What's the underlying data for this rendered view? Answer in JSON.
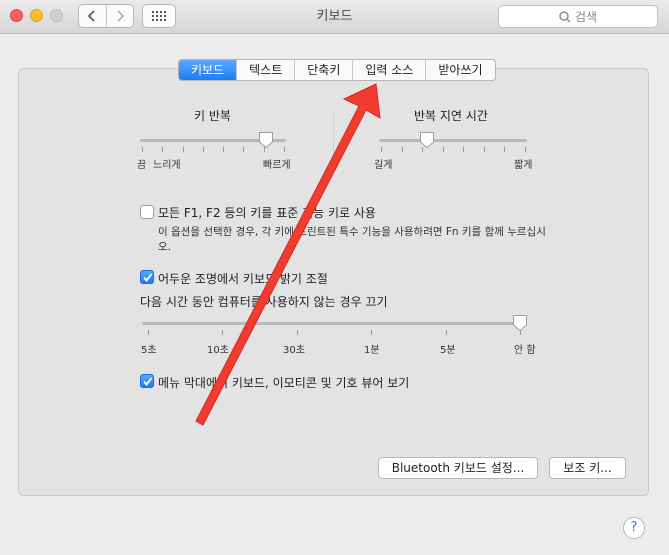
{
  "window": {
    "title": "키보드"
  },
  "search": {
    "placeholder": "검색"
  },
  "tabs": [
    {
      "label": "키보드",
      "active": true
    },
    {
      "label": "텍스트",
      "active": false
    },
    {
      "label": "단축키",
      "active": false
    },
    {
      "label": "입력 소스",
      "active": false
    },
    {
      "label": "받아쓰기",
      "active": false
    }
  ],
  "key_repeat": {
    "title": "키 반복",
    "left_label": "끔",
    "mid_label": "느리게",
    "right_label": "빠르게",
    "value_fraction": 0.87
  },
  "repeat_delay": {
    "title": "반복 지연 시간",
    "left_label": "길게",
    "right_label": "짧게",
    "value_fraction": 0.32
  },
  "fn_keys": {
    "checked": false,
    "label": "모든 F1, F2 등의 키를 표준 기능 키로 사용",
    "desc_line1": "이 옵션을 선택한 경우, 각 키에 프린트된 특수 기능을 사용하려면 Fn 키를 함께 누르십시",
    "desc_line2": "오."
  },
  "backlight": {
    "checked": true,
    "label": "어두운 조명에서 키보드 밝기 조절",
    "off_title": "다음 시간 동안 컴퓨터를 사용하지 않는 경우 끄기",
    "ticks": [
      "5초",
      "10초",
      "30초",
      "1분",
      "5분",
      "안 함"
    ],
    "value_fraction": 1.0
  },
  "menu_bar": {
    "checked": true,
    "label": "메뉴 막대에서 키보드, 이모티콘 및 기호 뷰어 보기"
  },
  "buttons": {
    "bluetooth": "Bluetooth 키보드 설정...",
    "modifier": "보조 키..."
  },
  "help": {
    "label": "?"
  },
  "colors": {
    "accent": "#1d7cf2",
    "annotation_arrow": "#f23c2f"
  }
}
